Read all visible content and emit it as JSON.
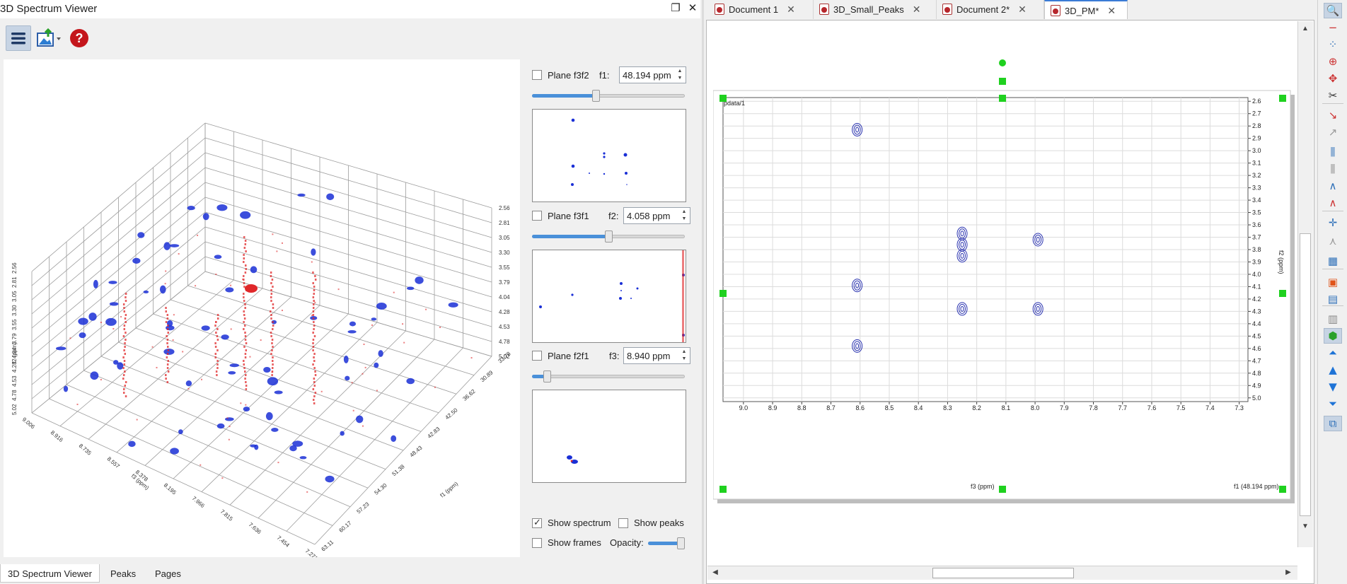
{
  "dock": {
    "title": "3D Spectrum Viewer",
    "float_icon": "float-icon",
    "close_icon": "close-icon"
  },
  "toolbar": {
    "icons": [
      "menu-icon",
      "export-image-icon",
      "help-icon"
    ]
  },
  "plot3d": {
    "y_ticks": [
      "2.56",
      "2.81",
      "3.05",
      "3.30",
      "3.55",
      "3.79",
      "4.04",
      "4.28",
      "4.53",
      "4.78",
      "5.02"
    ],
    "z_ticks": [
      "33.78",
      "30.89",
      "36.62",
      "42.50",
      "42.83",
      "48.43",
      "51.38",
      "54.30",
      "57.23",
      "60.17",
      "63.11"
    ],
    "x_ticks": [
      "9.006",
      "8.916",
      "8.735",
      "8.557",
      "8.378",
      "8.195",
      "7.966",
      "7.815",
      "7.636",
      "7.454",
      "7.271"
    ],
    "side_ticks": [
      "2.56",
      "2.81",
      "3.05",
      "3.30",
      "3.55",
      "3.79",
      "4.04",
      "4.28",
      "4.53",
      "4.78",
      "5.02"
    ],
    "x_axis_label": "f3 (ppm)",
    "z_axis_label": "f1 (ppm)",
    "side_axis_label": "f2 (ppm)",
    "colors": {
      "positive": "#1a2fd6",
      "negative": "#e0282a"
    }
  },
  "planes": [
    {
      "label": "Plane f3f2",
      "axis": "f1:",
      "value": "48.194 ppm",
      "checked": false,
      "slider_fraction": 0.41
    },
    {
      "label": "Plane f3f1",
      "axis": "f2:",
      "value": "4.058 ppm",
      "checked": false,
      "slider_fraction": 0.49
    },
    {
      "label": "Plane f2f1",
      "axis": "f3:",
      "value": "8.940 ppm",
      "checked": false,
      "slider_fraction": 0.08
    }
  ],
  "options": {
    "show_spectrum": {
      "label": "Show spectrum",
      "checked": true
    },
    "show_peaks": {
      "label": "Show peaks",
      "checked": false
    },
    "show_frames": {
      "label": "Show frames",
      "checked": false
    },
    "opacity_label": "Opacity:",
    "opacity_fraction": 0.9
  },
  "bottom_tabs": [
    "3D Spectrum Viewer",
    "Peaks",
    "Pages"
  ],
  "doc_tabs": [
    {
      "label": "Document 1",
      "active": false
    },
    {
      "label": "3D_Small_Peaks",
      "active": false
    },
    {
      "label": "Document 2*",
      "active": false
    },
    {
      "label": "3D_PM*",
      "active": true
    }
  ],
  "spectrum": {
    "dataset_label": "pdata/1",
    "x_axis_title": "f3 (ppm)",
    "y_axis_title": "f2 (ppm)",
    "plane_note": "f1 (48.194 ppm)",
    "x_ticks": [
      "9.0",
      "8.9",
      "8.8",
      "8.7",
      "8.6",
      "8.5",
      "8.4",
      "8.3",
      "8.2",
      "8.1",
      "8.0",
      "7.9",
      "7.8",
      "7.7",
      "7.6",
      "7.5",
      "7.4",
      "7.3"
    ],
    "y_ticks": [
      "2.6",
      "2.7",
      "2.8",
      "2.9",
      "3.0",
      "3.1",
      "3.2",
      "3.3",
      "3.4",
      "3.5",
      "3.6",
      "3.7",
      "3.8",
      "3.9",
      "4.0",
      "4.1",
      "4.2",
      "4.3",
      "4.4",
      "4.5",
      "4.6",
      "4.7",
      "4.8",
      "4.9",
      "5.0"
    ],
    "x_range": [
      9.07,
      7.27
    ],
    "y_range": [
      2.57,
      5.03
    ],
    "contour_color": "#2a33b0",
    "peaks": [
      {
        "f3": 8.61,
        "f2": 2.83
      },
      {
        "f3": 8.25,
        "f2": 3.67
      },
      {
        "f3": 8.25,
        "f2": 3.76
      },
      {
        "f3": 8.25,
        "f2": 3.85
      },
      {
        "f3": 7.99,
        "f2": 3.72
      },
      {
        "f3": 8.61,
        "f2": 4.09
      },
      {
        "f3": 8.25,
        "f2": 4.28
      },
      {
        "f3": 7.99,
        "f2": 4.28
      },
      {
        "f3": 8.61,
        "f2": 4.58
      }
    ],
    "handle_color": "#1fd11f"
  },
  "right_toolbar": {
    "icons": [
      "zoom-in-icon",
      "zoom-out-icon",
      "zoom-region-icon",
      "fit-icon",
      "pan-icon",
      "cut-icon",
      "peak-pick-icon",
      "peak-edit-icon",
      "multiplet-icon",
      "integrate-icon",
      "line-fit-icon",
      "baseline-icon",
      "crosshair-icon",
      "phase-icon",
      "stack-icon",
      "contour-icon",
      "projection-icon",
      "layout-icon",
      "cube-icon",
      "first-plane-icon",
      "prev-plane-icon",
      "next-plane-icon",
      "last-plane-icon",
      "sync-icon"
    ]
  }
}
